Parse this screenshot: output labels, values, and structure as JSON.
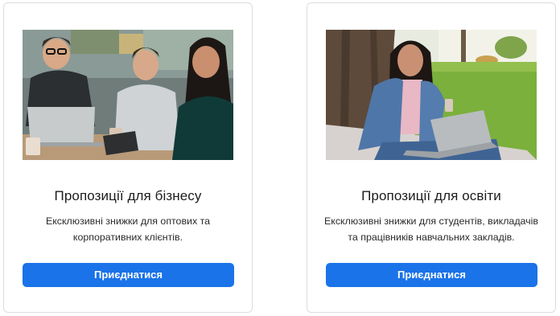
{
  "cards": [
    {
      "title": "Пропозиції для бізнесу",
      "description": "Ексклюзивні знижки для оптових та корпоративних клієнтів.",
      "button_label": "Приєднатися",
      "image": "photo-business-team-laptop"
    },
    {
      "title": "Пропозиції для освіти",
      "description": "Ексклюзивні знижки для студентів, викладачів та працівників навчальних закладів.",
      "button_label": "Приєднатися",
      "image": "photo-student-laptop-park"
    }
  ],
  "colors": {
    "button": "#1a73e8",
    "card_border": "#dcdcdc",
    "text": "#1d1d1d"
  }
}
